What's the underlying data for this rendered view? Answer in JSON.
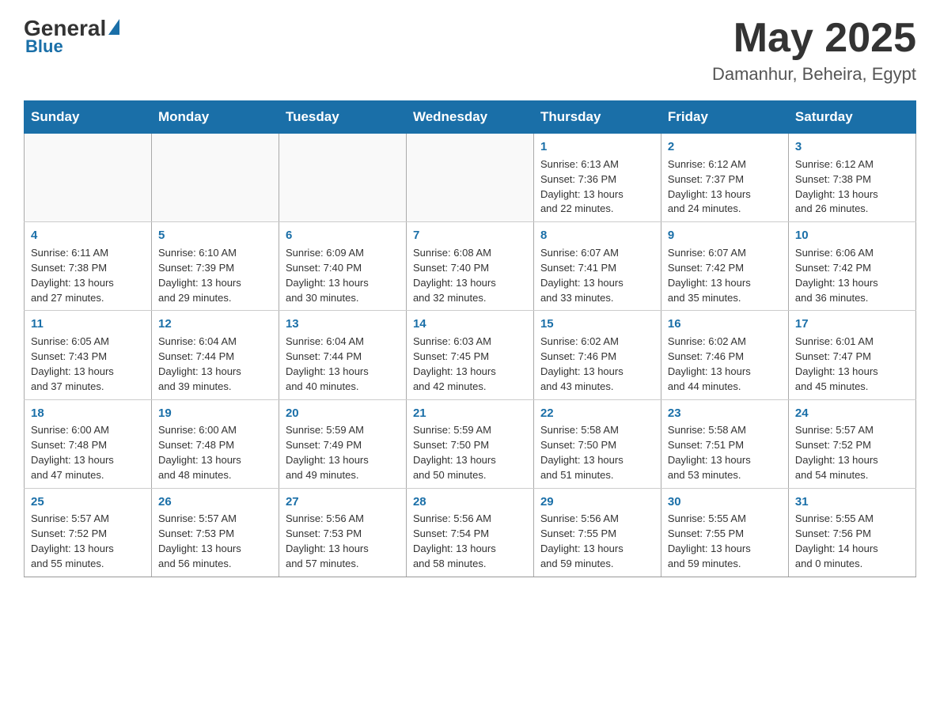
{
  "header": {
    "logo": {
      "general": "General",
      "blue": "Blue"
    },
    "title": "May 2025",
    "location": "Damanhur, Beheira, Egypt"
  },
  "weekdays": [
    "Sunday",
    "Monday",
    "Tuesday",
    "Wednesday",
    "Thursday",
    "Friday",
    "Saturday"
  ],
  "weeks": [
    [
      {
        "day": "",
        "info": ""
      },
      {
        "day": "",
        "info": ""
      },
      {
        "day": "",
        "info": ""
      },
      {
        "day": "",
        "info": ""
      },
      {
        "day": "1",
        "info": "Sunrise: 6:13 AM\nSunset: 7:36 PM\nDaylight: 13 hours\nand 22 minutes."
      },
      {
        "day": "2",
        "info": "Sunrise: 6:12 AM\nSunset: 7:37 PM\nDaylight: 13 hours\nand 24 minutes."
      },
      {
        "day": "3",
        "info": "Sunrise: 6:12 AM\nSunset: 7:38 PM\nDaylight: 13 hours\nand 26 minutes."
      }
    ],
    [
      {
        "day": "4",
        "info": "Sunrise: 6:11 AM\nSunset: 7:38 PM\nDaylight: 13 hours\nand 27 minutes."
      },
      {
        "day": "5",
        "info": "Sunrise: 6:10 AM\nSunset: 7:39 PM\nDaylight: 13 hours\nand 29 minutes."
      },
      {
        "day": "6",
        "info": "Sunrise: 6:09 AM\nSunset: 7:40 PM\nDaylight: 13 hours\nand 30 minutes."
      },
      {
        "day": "7",
        "info": "Sunrise: 6:08 AM\nSunset: 7:40 PM\nDaylight: 13 hours\nand 32 minutes."
      },
      {
        "day": "8",
        "info": "Sunrise: 6:07 AM\nSunset: 7:41 PM\nDaylight: 13 hours\nand 33 minutes."
      },
      {
        "day": "9",
        "info": "Sunrise: 6:07 AM\nSunset: 7:42 PM\nDaylight: 13 hours\nand 35 minutes."
      },
      {
        "day": "10",
        "info": "Sunrise: 6:06 AM\nSunset: 7:42 PM\nDaylight: 13 hours\nand 36 minutes."
      }
    ],
    [
      {
        "day": "11",
        "info": "Sunrise: 6:05 AM\nSunset: 7:43 PM\nDaylight: 13 hours\nand 37 minutes."
      },
      {
        "day": "12",
        "info": "Sunrise: 6:04 AM\nSunset: 7:44 PM\nDaylight: 13 hours\nand 39 minutes."
      },
      {
        "day": "13",
        "info": "Sunrise: 6:04 AM\nSunset: 7:44 PM\nDaylight: 13 hours\nand 40 minutes."
      },
      {
        "day": "14",
        "info": "Sunrise: 6:03 AM\nSunset: 7:45 PM\nDaylight: 13 hours\nand 42 minutes."
      },
      {
        "day": "15",
        "info": "Sunrise: 6:02 AM\nSunset: 7:46 PM\nDaylight: 13 hours\nand 43 minutes."
      },
      {
        "day": "16",
        "info": "Sunrise: 6:02 AM\nSunset: 7:46 PM\nDaylight: 13 hours\nand 44 minutes."
      },
      {
        "day": "17",
        "info": "Sunrise: 6:01 AM\nSunset: 7:47 PM\nDaylight: 13 hours\nand 45 minutes."
      }
    ],
    [
      {
        "day": "18",
        "info": "Sunrise: 6:00 AM\nSunset: 7:48 PM\nDaylight: 13 hours\nand 47 minutes."
      },
      {
        "day": "19",
        "info": "Sunrise: 6:00 AM\nSunset: 7:48 PM\nDaylight: 13 hours\nand 48 minutes."
      },
      {
        "day": "20",
        "info": "Sunrise: 5:59 AM\nSunset: 7:49 PM\nDaylight: 13 hours\nand 49 minutes."
      },
      {
        "day": "21",
        "info": "Sunrise: 5:59 AM\nSunset: 7:50 PM\nDaylight: 13 hours\nand 50 minutes."
      },
      {
        "day": "22",
        "info": "Sunrise: 5:58 AM\nSunset: 7:50 PM\nDaylight: 13 hours\nand 51 minutes."
      },
      {
        "day": "23",
        "info": "Sunrise: 5:58 AM\nSunset: 7:51 PM\nDaylight: 13 hours\nand 53 minutes."
      },
      {
        "day": "24",
        "info": "Sunrise: 5:57 AM\nSunset: 7:52 PM\nDaylight: 13 hours\nand 54 minutes."
      }
    ],
    [
      {
        "day": "25",
        "info": "Sunrise: 5:57 AM\nSunset: 7:52 PM\nDaylight: 13 hours\nand 55 minutes."
      },
      {
        "day": "26",
        "info": "Sunrise: 5:57 AM\nSunset: 7:53 PM\nDaylight: 13 hours\nand 56 minutes."
      },
      {
        "day": "27",
        "info": "Sunrise: 5:56 AM\nSunset: 7:53 PM\nDaylight: 13 hours\nand 57 minutes."
      },
      {
        "day": "28",
        "info": "Sunrise: 5:56 AM\nSunset: 7:54 PM\nDaylight: 13 hours\nand 58 minutes."
      },
      {
        "day": "29",
        "info": "Sunrise: 5:56 AM\nSunset: 7:55 PM\nDaylight: 13 hours\nand 59 minutes."
      },
      {
        "day": "30",
        "info": "Sunrise: 5:55 AM\nSunset: 7:55 PM\nDaylight: 13 hours\nand 59 minutes."
      },
      {
        "day": "31",
        "info": "Sunrise: 5:55 AM\nSunset: 7:56 PM\nDaylight: 14 hours\nand 0 minutes."
      }
    ]
  ]
}
